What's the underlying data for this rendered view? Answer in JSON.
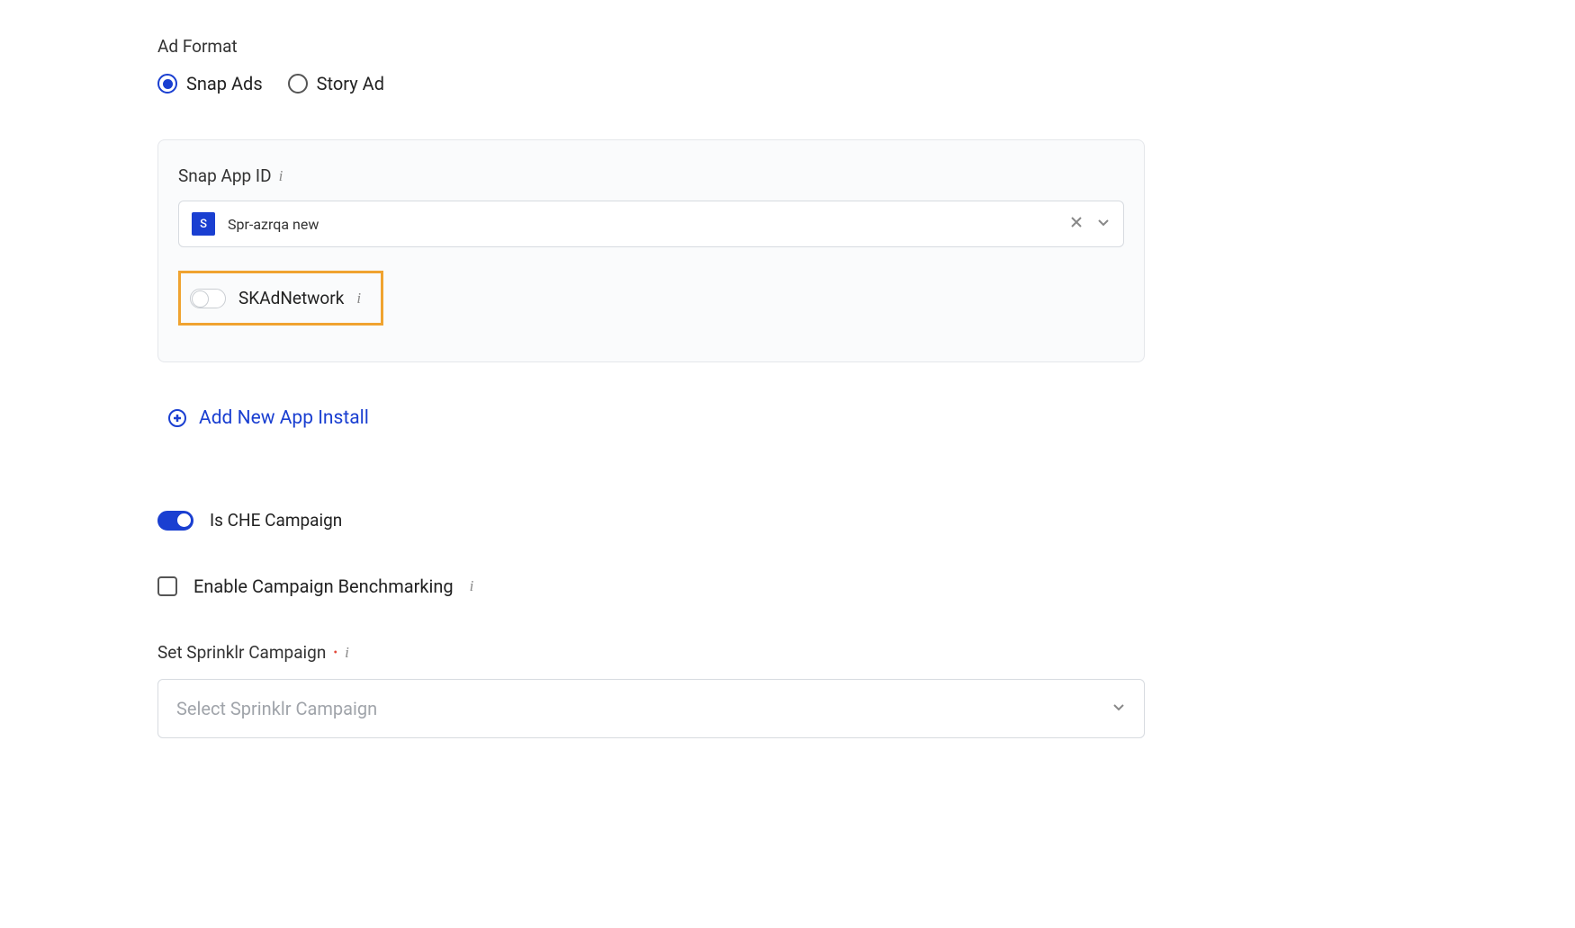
{
  "ad_format": {
    "label": "Ad Format",
    "options": [
      {
        "label": "Snap Ads",
        "selected": true
      },
      {
        "label": "Story Ad",
        "selected": false
      }
    ]
  },
  "snap_app": {
    "label": "Snap App ID",
    "icon_letter": "S",
    "selected_value": "Spr-azrqa new",
    "skadnetwork_label": "SKAdNetwork"
  },
  "add_app_install": {
    "label": "Add New App Install"
  },
  "che_campaign": {
    "label": "Is CHE Campaign",
    "enabled": true
  },
  "benchmarking": {
    "label": "Enable Campaign Benchmarking",
    "checked": false
  },
  "sprinklr_campaign": {
    "label": "Set Sprinklr Campaign",
    "placeholder": "Select Sprinklr Campaign"
  }
}
